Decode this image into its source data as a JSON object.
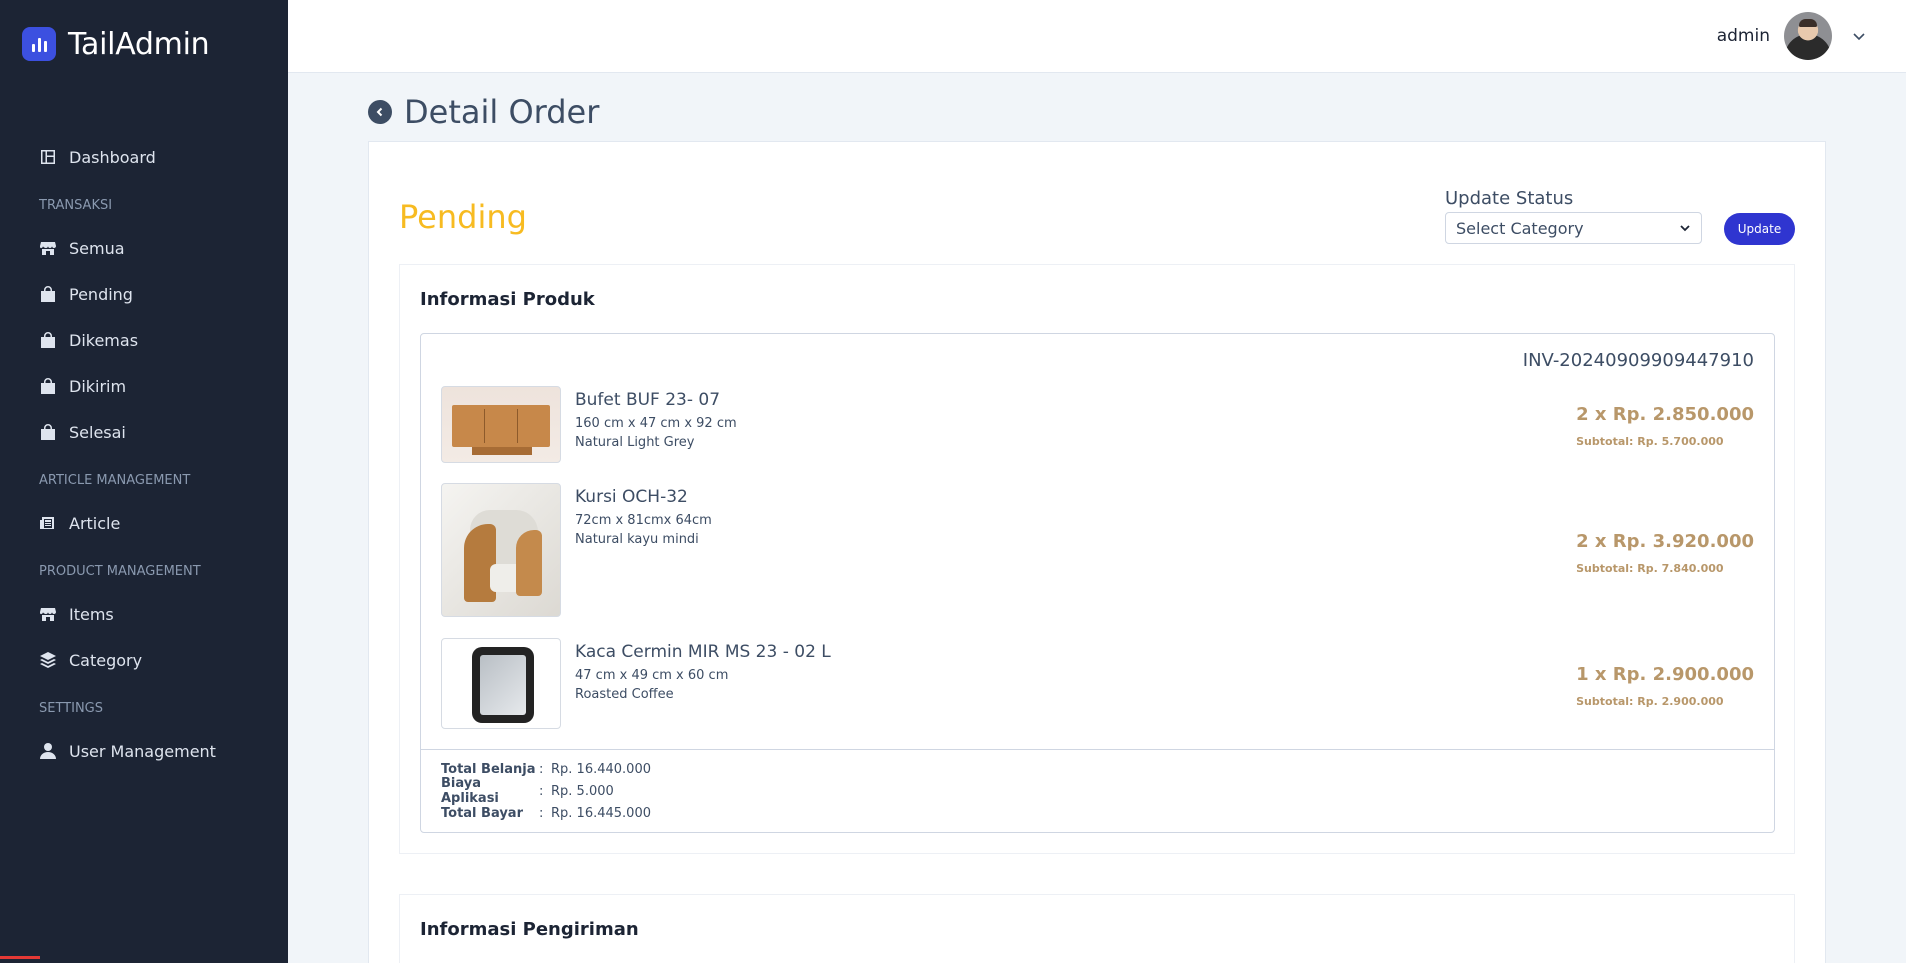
{
  "sidebar": {
    "brand": "TailAdmin",
    "items": {
      "dashboard": "Dashboard",
      "transaksi_label": "TRANSAKSI",
      "semua": "Semua",
      "pending": "Pending",
      "dikemas": "Dikemas",
      "dikirim": "Dikirim",
      "selesai": "Selesai",
      "article_label": "ARTICLE MANAGEMENT",
      "article": "Article",
      "product_label": "PRODUCT MANAGEMENT",
      "items": "Items",
      "category": "Category",
      "settings_label": "SETTINGS",
      "user_management": "User Management"
    }
  },
  "header": {
    "username": "admin"
  },
  "page": {
    "title": "Detail Order",
    "status": "Pending",
    "update_status_label": "Update Status",
    "select_value": "Select Category",
    "update_button": "Update"
  },
  "produk": {
    "section_title": "Informasi Produk",
    "invoice": "INV-20240909909447910",
    "items": [
      {
        "name": "Bufet BUF 23- 07",
        "size": "160 cm x 47 cm x 92 cm",
        "color": "Natural Light Grey",
        "qty_price": "2 x Rp. 2.850.000",
        "subtotal": "Subtotal: Rp. 5.700.000"
      },
      {
        "name": "Kursi OCH-32",
        "size": "72cm x 81cmx 64cm",
        "color": "Natural kayu mindi",
        "qty_price": "2 x Rp. 3.920.000",
        "subtotal": "Subtotal: Rp. 7.840.000"
      },
      {
        "name": "Kaca Cermin MIR MS 23 - 02 L",
        "size": "47 cm x 49 cm x 60 cm",
        "color": "Roasted Coffee",
        "qty_price": "1 x Rp. 2.900.000",
        "subtotal": "Subtotal: Rp. 2.900.000"
      }
    ],
    "totals": {
      "separator": ":",
      "belanja_label": "Total Belanja",
      "belanja": "Rp. 16.440.000",
      "biaya_label": "Biaya Aplikasi",
      "biaya": "Rp. 5.000",
      "bayar_label": "Total Bayar",
      "bayar": "Rp. 16.445.000"
    }
  },
  "pengiriman": {
    "section_title": "Informasi Pengiriman"
  },
  "icons": {
    "brand": "bar-chart-logo-icon",
    "dashboard": "dashboard-icon",
    "store": "store-icon",
    "bag": "shopping-bag-icon",
    "article": "newspaper-icon",
    "layers": "layers-icon",
    "user": "user-icon",
    "back": "chevron-left-icon",
    "dropdown": "chevron-down-icon"
  },
  "colors": {
    "sidebar_bg": "#1c2434",
    "status_pending": "#f7bb21",
    "update_button": "#2f35d0",
    "price": "#b8976a"
  }
}
